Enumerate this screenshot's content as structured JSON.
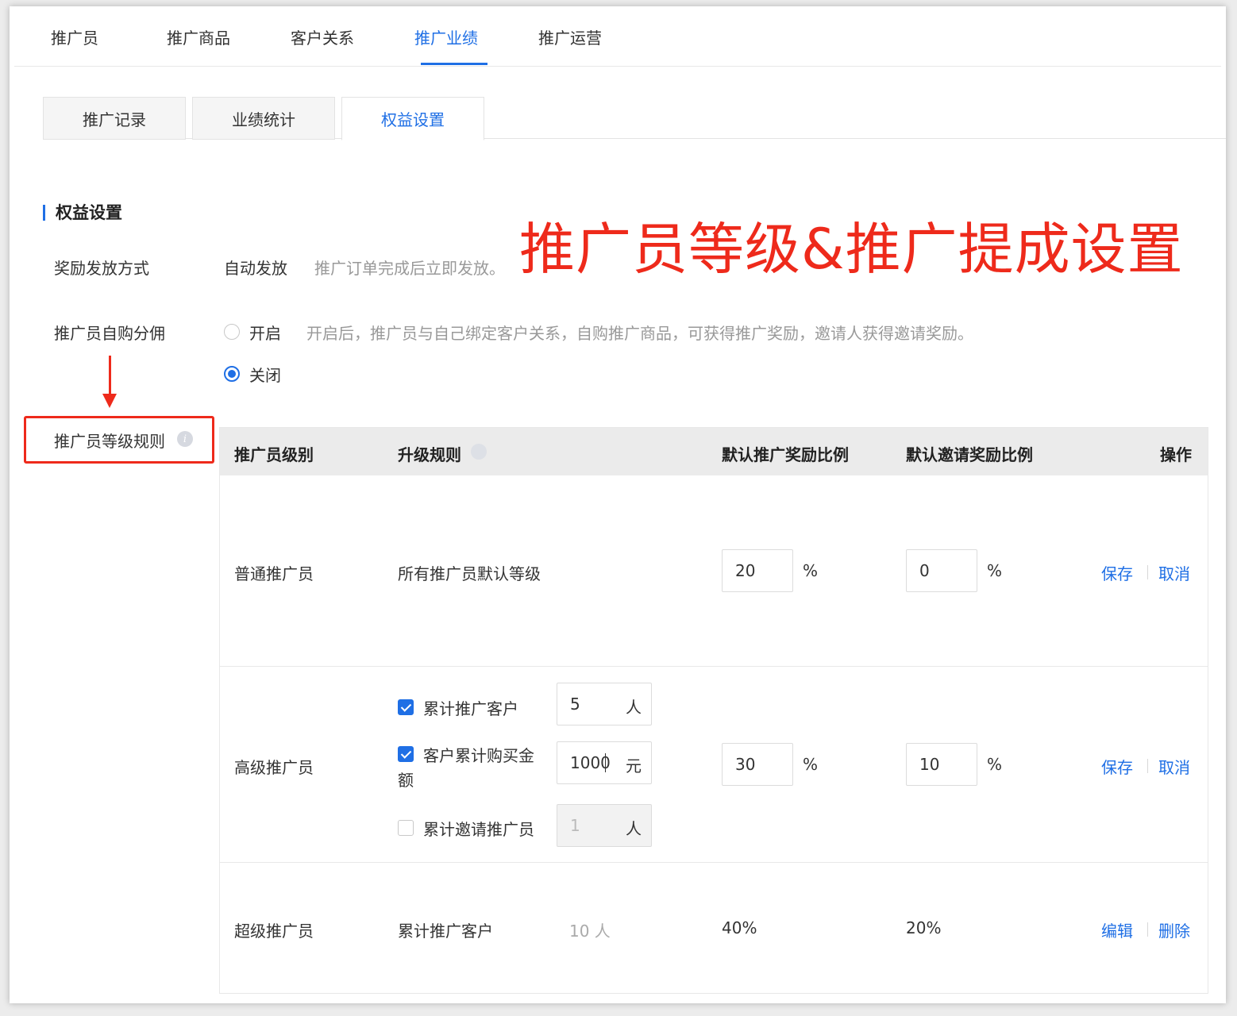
{
  "top_tabs": [
    {
      "label": "推广员"
    },
    {
      "label": "推广商品"
    },
    {
      "label": "客户关系"
    },
    {
      "label": "推广业绩",
      "active": true
    },
    {
      "label": "推广运营"
    }
  ],
  "sub_tabs": [
    {
      "label": "推广记录"
    },
    {
      "label": "业绩统计"
    },
    {
      "label": "权益设置",
      "active": true
    }
  ],
  "section": {
    "title": "权益设置"
  },
  "annotation": {
    "headline": "推广员等级&推广提成设置",
    "color": "#ee2a1b"
  },
  "reward_method": {
    "label": "奖励发放方式",
    "value": "自动发放",
    "hint": "推广订单完成后立即发放。"
  },
  "self_purchase": {
    "label": "推广员自购分佣",
    "options": [
      {
        "label": "开启",
        "hint": "开启后，推广员与自己绑定客户关系，自购推广商品，可获得推广奖励，邀请人获得邀请奖励。",
        "checked": false
      },
      {
        "label": "关闭",
        "checked": true
      }
    ]
  },
  "level_rules": {
    "label": "推广员等级规则",
    "info_icon": "info-icon"
  },
  "table": {
    "headers": {
      "level": "推广员级别",
      "rule": "升级规则",
      "promo_ratio": "默认推广奖励比例",
      "invite_ratio": "默认邀请奖励比例",
      "action": "操作"
    },
    "rows": [
      {
        "level": "普通推广员",
        "rule": "所有推广员默认等级",
        "promo_ratio": "20",
        "invite_ratio": "0",
        "percent": "%",
        "actions": [
          "保存",
          "取消"
        ]
      },
      {
        "level": "高级推广员",
        "conditions": [
          {
            "label": "累计推广客户",
            "value": "5",
            "unit": "人",
            "checked": true
          },
          {
            "label_line1": "客户累计购买金",
            "label_line2": "额",
            "value": "1000",
            "unit": "元",
            "checked": true
          },
          {
            "label": "累计邀请推广员",
            "value": "1",
            "unit": "人",
            "checked": false
          }
        ],
        "promo_ratio": "30",
        "invite_ratio": "10",
        "percent": "%",
        "actions": [
          "保存",
          "取消"
        ]
      },
      {
        "level": "超级推广员",
        "rule": "累计推广客户",
        "rule_value": "10 人",
        "promo_ratio": "40%",
        "invite_ratio": "20%",
        "actions": [
          "编辑",
          "删除"
        ]
      }
    ]
  },
  "colors": {
    "accent": "#1f6fe5",
    "annotation": "#ee2a1b"
  }
}
